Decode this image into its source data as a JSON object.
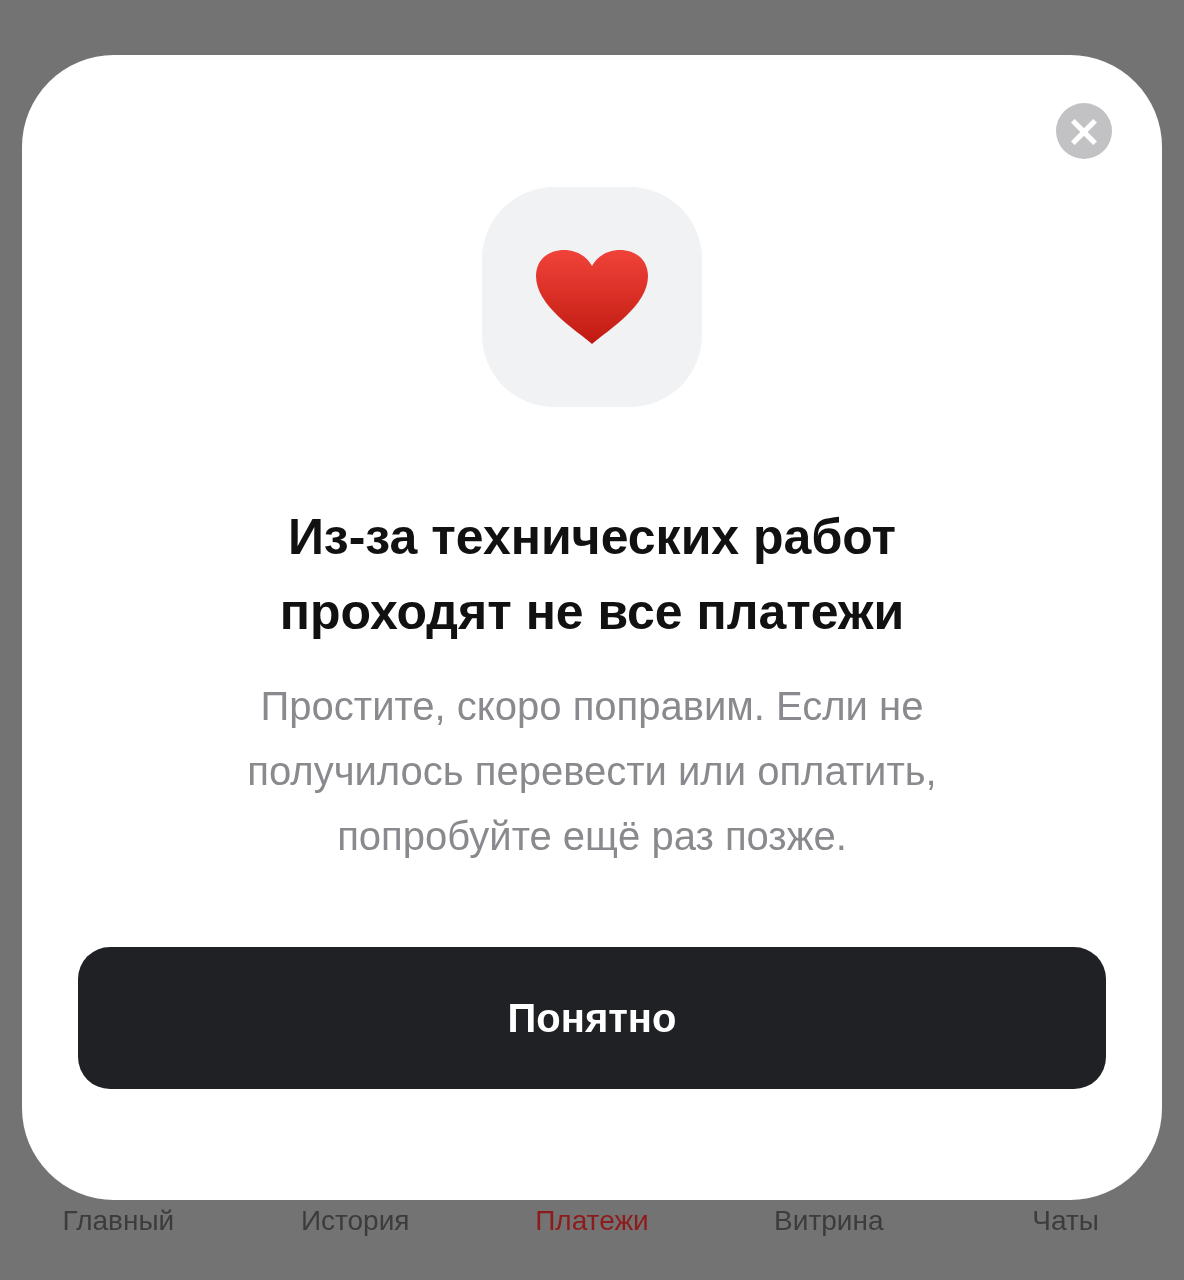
{
  "tabs": [
    {
      "label": "Главный",
      "selected": false
    },
    {
      "label": "История",
      "selected": false
    },
    {
      "label": "Платежи",
      "selected": true
    },
    {
      "label": "Витрина",
      "selected": false
    },
    {
      "label": "Чаты",
      "selected": false
    }
  ],
  "dialog": {
    "close": "×",
    "title": "Из-за технических работ проходят не все платежи",
    "message": "Простите, скоро поправим. Если не получилось перевести или оплатить, попробуйте ещё раз позже.",
    "button": "Понятно"
  }
}
